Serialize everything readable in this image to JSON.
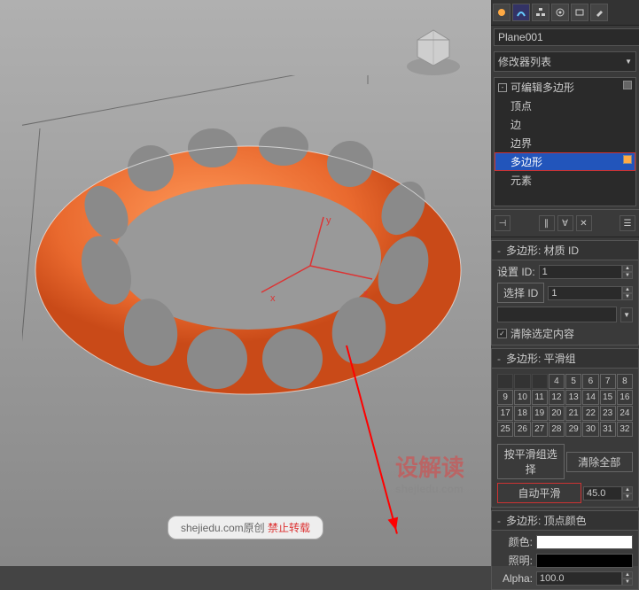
{
  "object_name": "Plane001",
  "modifier_list_label": "修改器列表",
  "stack": {
    "root": "可编辑多边形",
    "sub": [
      "顶点",
      "边",
      "边界",
      "多边形",
      "元素"
    ],
    "selected_index": 3
  },
  "rollouts": {
    "matid": {
      "title": "多边形: 材质 ID",
      "set_label": "设置 ID:",
      "set_value": "1",
      "select_label": "选择 ID",
      "select_value": "1",
      "clear_label": "清除选定内容",
      "clear_checked": true
    },
    "smoothing": {
      "title": "多边形: 平滑组",
      "cells": [
        "",
        "",
        "",
        "4",
        "5",
        "6",
        "7",
        "8",
        "9",
        "10",
        "11",
        "12",
        "13",
        "14",
        "15",
        "16",
        "17",
        "18",
        "19",
        "20",
        "21",
        "22",
        "23",
        "24",
        "25",
        "26",
        "27",
        "28",
        "29",
        "30",
        "31",
        "32"
      ],
      "by_sg_label": "按平滑组选择",
      "clear_all_label": "清除全部",
      "auto_label": "自动平滑",
      "auto_value": "45.0"
    },
    "vcolor": {
      "title": "多边形: 顶点颜色",
      "color_label": "颜色:",
      "illum_label": "照明:",
      "alpha_label": "Alpha:",
      "alpha_value": "100.0"
    }
  },
  "watermark": {
    "big": "设解读",
    "url": "shejiedu.com",
    "footer": "shejiedu.com原创",
    "footer2": "禁止转载"
  }
}
